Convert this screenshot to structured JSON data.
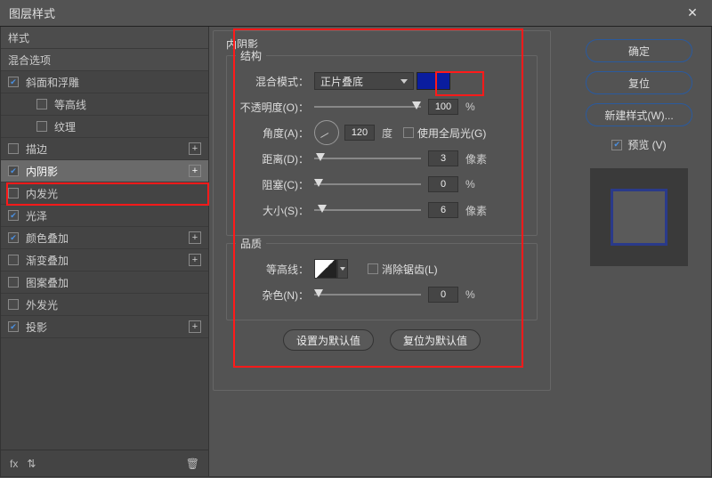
{
  "window": {
    "title": "图层样式",
    "close": "✕"
  },
  "sidebar": {
    "styles_header": "样式",
    "blend_options": "混合选项",
    "items": [
      {
        "label": "斜面和浮雕",
        "checked": true,
        "plus": false
      },
      {
        "label": "等高线",
        "checked": false,
        "plus": false,
        "sub": true
      },
      {
        "label": "纹理",
        "checked": false,
        "plus": false,
        "sub": true
      },
      {
        "label": "描边",
        "checked": false,
        "plus": true
      },
      {
        "label": "内阴影",
        "checked": true,
        "plus": true,
        "selected": true
      },
      {
        "label": "内发光",
        "checked": false,
        "plus": false
      },
      {
        "label": "光泽",
        "checked": true,
        "plus": false
      },
      {
        "label": "颜色叠加",
        "checked": true,
        "plus": true
      },
      {
        "label": "渐变叠加",
        "checked": false,
        "plus": true
      },
      {
        "label": "图案叠加",
        "checked": false,
        "plus": false
      },
      {
        "label": "外发光",
        "checked": false,
        "plus": false
      },
      {
        "label": "投影",
        "checked": true,
        "plus": true
      }
    ],
    "footer": {
      "fx": "fx",
      "trash": "🗑"
    }
  },
  "panel": {
    "title": "内阴影",
    "structure": {
      "group_title": "结构",
      "blend_mode_label": "混合模式：",
      "blend_mode_value": "正片叠底",
      "opacity_label": "不透明度(O)：",
      "opacity_value": "100",
      "opacity_unit": "%",
      "angle_label": "角度(A)：",
      "angle_value": "120",
      "angle_unit": "度",
      "global_light_label": "使用全局光(G)",
      "distance_label": "距离(D)：",
      "distance_value": "3",
      "distance_unit": "像素",
      "choke_label": "阻塞(C)：",
      "choke_value": "0",
      "choke_unit": "%",
      "size_label": "大小(S)：",
      "size_value": "6",
      "size_unit": "像素"
    },
    "quality": {
      "group_title": "品质",
      "contour_label": "等高线：",
      "antialias_label": "消除锯齿(L)",
      "noise_label": "杂色(N)：",
      "noise_value": "0",
      "noise_unit": "%"
    },
    "buttons": {
      "default": "设置为默认值",
      "reset": "复位为默认值"
    }
  },
  "right": {
    "ok": "确定",
    "reset": "复位",
    "new_style": "新建样式(W)...",
    "preview": "预览 (V)"
  },
  "colors": {
    "swatch": "#0a1d9f"
  }
}
